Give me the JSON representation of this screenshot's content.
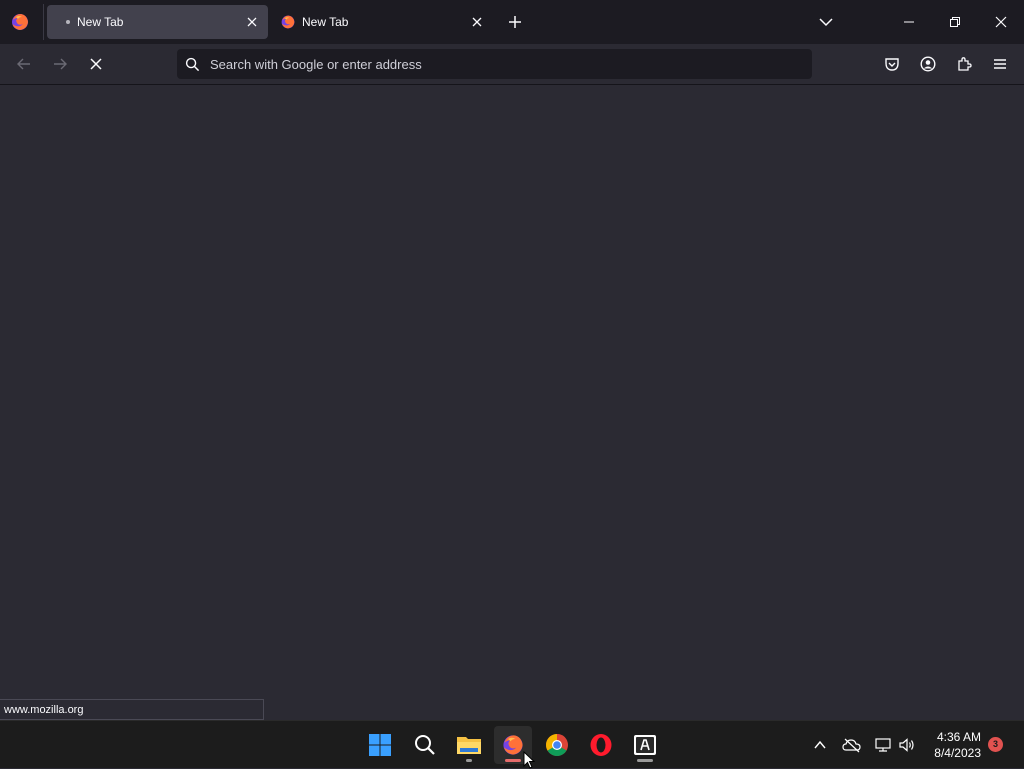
{
  "browser": {
    "tabs": [
      {
        "title": "New Tab",
        "state": "active",
        "loading_indicator": "dot"
      },
      {
        "title": "New Tab",
        "state": "inactive",
        "favicon": "firefox-icon"
      }
    ],
    "urlbar": {
      "placeholder": "Search with Google or enter address",
      "value": ""
    },
    "nav_state": {
      "back_enabled": false,
      "forward_enabled": false,
      "loading": true
    },
    "toolbar_icons": [
      "pocket-icon",
      "account-icon",
      "extensions-icon",
      "menu-icon"
    ],
    "status_text": "www.mozilla.org"
  },
  "taskbar": {
    "apps": [
      {
        "name": "start-icon"
      },
      {
        "name": "search-icon"
      },
      {
        "name": "file-explorer-icon",
        "indicator": "small"
      },
      {
        "name": "firefox-icon",
        "active": true,
        "indicator": "active"
      },
      {
        "name": "chrome-icon"
      },
      {
        "name": "opera-icon"
      },
      {
        "name": "adobe-app-icon",
        "indicator": "small"
      }
    ],
    "clock": {
      "time": "4:36 AM",
      "date": "8/4/2023"
    },
    "notification_count": "3"
  },
  "colors": {
    "tabbar_bg": "#1c1b22",
    "content_bg": "#2b2a33",
    "active_tab_bg": "#42414d",
    "accent_firefox": "#e66000",
    "notification_badge": "#e15250"
  }
}
